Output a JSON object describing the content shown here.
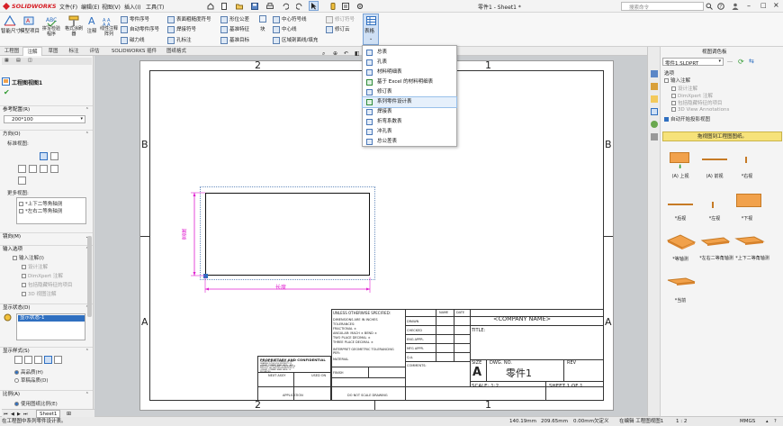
{
  "titlebar": {
    "brand": "SOLIDWORKS",
    "menus": [
      "文件(F)",
      "编辑(E)",
      "视图(V)",
      "插入(I)",
      "工具(T)"
    ],
    "doc_title": "零件1 - Sheet1 *",
    "search_placeholder": "搜索命令"
  },
  "ribbon": {
    "big_buttons": [
      "智能尺寸",
      "模型项目",
      "拼写检验程序",
      "格式涂刷器",
      "注释",
      "线性注释阵列"
    ],
    "col1": [
      "零件序号",
      "自动零件序号",
      "磁力线"
    ],
    "col2": [
      "表面粗糙度符号",
      "焊接符号",
      "孔标注"
    ],
    "col3": [
      "形位公差",
      "基准特征",
      "基准目标"
    ],
    "col4": [
      "中心符号线",
      "中心线",
      "区域剖面线/填充"
    ],
    "col5": [
      "修订符号",
      "修订云"
    ],
    "block_label": "块",
    "table_label": "表格"
  },
  "cmdtabs": [
    "工程图",
    "注解",
    "草图",
    "标注",
    "评估",
    "SOLIDWORKS 插件",
    "图纸格式"
  ],
  "table_menu": {
    "items": [
      "总表",
      "孔表",
      "材料明细表",
      "基于 Excel 的材料明细表",
      "修订表",
      "系列零件设计表",
      "焊接表",
      "折弯系数表",
      "冲孔表",
      "总公差表"
    ],
    "highlighted_index": 5
  },
  "leftpane": {
    "title": "工程图视图1",
    "ref_config_label": "参考配置(R)",
    "ref_config_value": "200*100",
    "orientation_label": "方向(O)",
    "standard_views_label": "标准视图:",
    "more_views_label": "更多视图:",
    "more_views": [
      "*上下二等角轴测",
      "*左右二等角轴测"
    ],
    "mirror_label": "镜向(M)",
    "import_label": "输入选项",
    "import_items": [
      "输入注解(I)",
      "设计注解",
      "DimXpert 注解",
      "包括隐藏特征的项目",
      "3D 视图注解"
    ],
    "display_state_label": "显示状态(D)",
    "display_state_value": "显示状态-1",
    "display_style_label": "显示样式(S)",
    "quality_items": [
      "高品质(H)",
      "草稿品质(D)"
    ],
    "scale_label": "比例(A)",
    "scale_option": "使用图纸比例(E)"
  },
  "sheet": {
    "zones_top": [
      "2",
      "1"
    ],
    "zones_bottom": [
      "2",
      "1"
    ],
    "zones_left": [
      "B",
      "A"
    ],
    "zones_right": [
      "B",
      "A"
    ],
    "dim_length": "长度",
    "dim_width": "宽度",
    "title_block": {
      "company": "<COMPANY NAME>",
      "title_label": "TITLE:",
      "size_label": "SIZE",
      "size_value": "A",
      "dwg_no_label": "DWG.  NO.",
      "dwg_no_value": "零件1",
      "rev_label": "REV",
      "scale": "SCALE: 1:2",
      "sheet": "SHEET 1 OF 1",
      "name": "NAME",
      "date": "DATE",
      "drawn": "DRAWN",
      "checked": "CHECKED",
      "eng_appr": "ENG APPR.",
      "mfg_appr": "MFG APPR.",
      "qa": "Q.A.",
      "comments": "COMMENTS:",
      "unless": "UNLESS OTHERWISE SPECIFIED:",
      "dims_lines": [
        "DIMENSIONS ARE IN INCHES",
        "TOLERANCES:",
        "FRACTIONAL ±",
        "ANGULAR: MACH ±  BEND ±",
        "TWO PLACE DECIMAL  ±",
        "THREE PLACE DECIMAL  ±"
      ],
      "interpret": "INTERPRET GEOMETRIC TOLERANCING PER:",
      "material": "MATERIAL",
      "finish": "FINISH",
      "next_assy": "NEXT ASSY",
      "used_on": "USED ON",
      "application": "APPLICATION",
      "do_not_scale": "DO NOT SCALE DRAWING",
      "proprietary_title": "PROPRIETARY AND CONFIDENTIAL",
      "proprietary_text": [
        "THE INFORMATION CONTAINED IN THIS",
        "DRAWING IS THE SOLE PROPERTY OF",
        "<INSERT COMPANY NAME HERE>. ANY",
        "REPRODUCTION IN PART OR AS A WHOLE",
        "WITHOUT THE WRITTEN PERMISSION OF",
        "<INSERT COMPANY NAME HERE> IS",
        "PROHIBITED."
      ]
    }
  },
  "rightpane": {
    "title": "视图调色板",
    "part_select": "零件1.SLDPRT",
    "options_label": "选项",
    "options": [
      "输入注解",
      "设计注解",
      "DimXpert 注解",
      "包括隐藏特征的项目",
      "3D View Annotations",
      "自动开始投影视图"
    ],
    "hint": "拖视图到工程图图纸。",
    "views": [
      "(A) 上视",
      "(A) 前视",
      "*右视",
      "*后视",
      "*左视",
      "*下视",
      "*等轴测",
      "*左右二等角轴测",
      "*上下二等角轴测",
      "*当前"
    ]
  },
  "statusbar": {
    "message": "在工程图中系列零件设计表。",
    "sheet_tab": "Sheet1",
    "coord_x": "140.19mm",
    "coord_y": "209.65mm",
    "coord_z": "0.00mm",
    "state": "欠定义",
    "mode": "在编辑 工程图视图1",
    "scale": "1 : 2",
    "units": "MMGS"
  },
  "colors": {
    "accent": "#2f6fc0",
    "brand_red": "#d61f26",
    "dim_magenta": "#e01fd0",
    "hint_yellow": "#f6e27a",
    "plate_orange": "#f1a14b"
  }
}
